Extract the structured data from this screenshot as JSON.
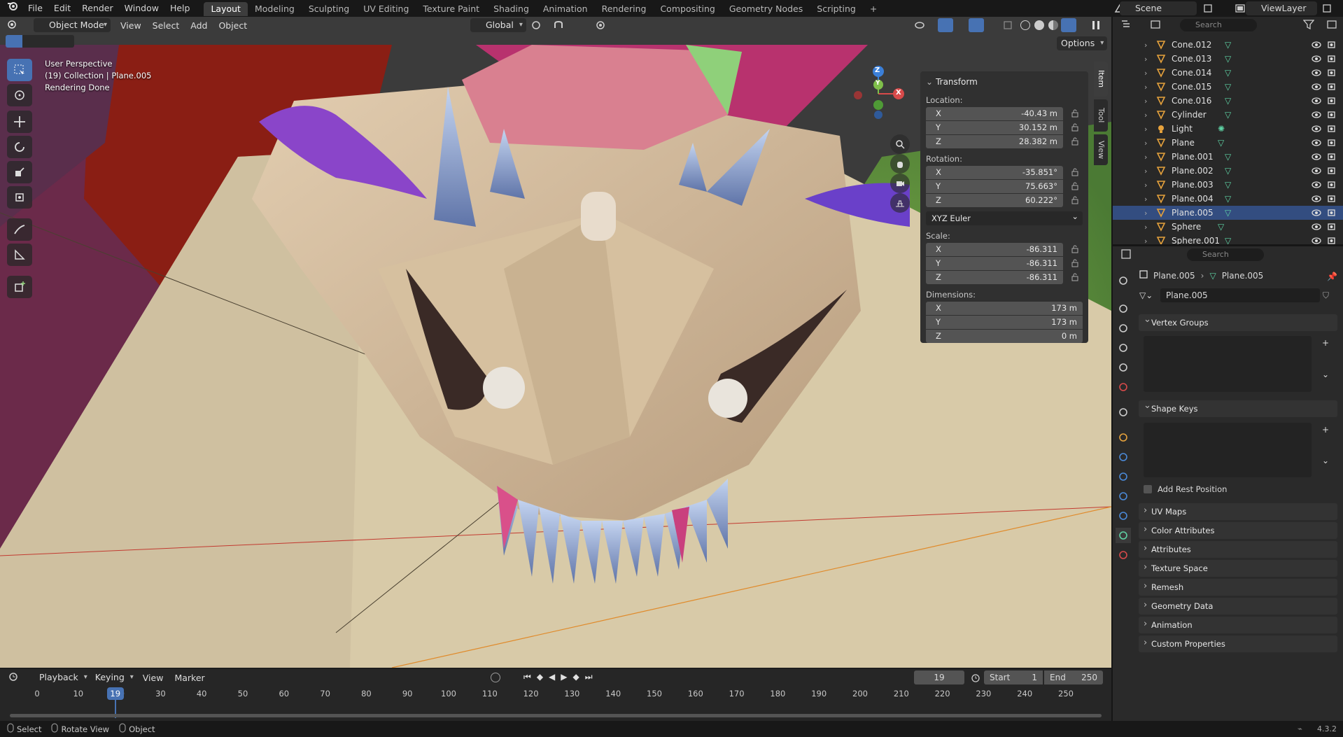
{
  "topbar": {
    "menus": [
      "File",
      "Edit",
      "Render",
      "Window",
      "Help"
    ],
    "workspaces": [
      "Layout",
      "Modeling",
      "Sculpting",
      "UV Editing",
      "Texture Paint",
      "Shading",
      "Animation",
      "Rendering",
      "Compositing",
      "Geometry Nodes",
      "Scripting"
    ],
    "add_workspace": "+",
    "scene": "Scene",
    "view_layer": "ViewLayer"
  },
  "viewport": {
    "mode": "Object Mode",
    "menus": [
      "View",
      "Select",
      "Add",
      "Object"
    ],
    "orientation": "Global",
    "options_label": "Options",
    "overlay_line1": "User Perspective",
    "overlay_line2": "(19) Collection | Plane.005",
    "overlay_line3": "Rendering Done",
    "gizmo_axes": [
      "Z",
      "Y",
      "X"
    ]
  },
  "npanel": {
    "title": "Transform",
    "location_label": "Location:",
    "location": [
      {
        "axis": "X",
        "value": "-40.43 m"
      },
      {
        "axis": "Y",
        "value": "30.152 m"
      },
      {
        "axis": "Z",
        "value": "28.382 m"
      }
    ],
    "rotation_label": "Rotation:",
    "rotation": [
      {
        "axis": "X",
        "value": "-35.851°"
      },
      {
        "axis": "Y",
        "value": "75.663°"
      },
      {
        "axis": "Z",
        "value": "60.222°"
      }
    ],
    "rotation_mode": "XYZ Euler",
    "scale_label": "Scale:",
    "scale": [
      {
        "axis": "X",
        "value": "-86.311"
      },
      {
        "axis": "Y",
        "value": "-86.311"
      },
      {
        "axis": "Z",
        "value": "-86.311"
      }
    ],
    "dimensions_label": "Dimensions:",
    "dimensions": [
      {
        "axis": "X",
        "value": "173 m"
      },
      {
        "axis": "Y",
        "value": "173 m"
      },
      {
        "axis": "Z",
        "value": "0 m"
      }
    ],
    "tabs": [
      "Item",
      "Tool",
      "View"
    ]
  },
  "outliner": {
    "search_placeholder": "Search",
    "items": [
      "Cone.012",
      "Cone.013",
      "Cone.014",
      "Cone.015",
      "Cone.016",
      "Cylinder",
      "Light",
      "Plane",
      "Plane.001",
      "Plane.002",
      "Plane.003",
      "Plane.004",
      "Plane.005",
      "Sphere",
      "Sphere.001"
    ],
    "selected": "Plane.005"
  },
  "properties": {
    "search_placeholder": "Search",
    "breadcrumb_object": "Plane.005",
    "breadcrumb_mesh": "Plane.005",
    "mesh_name": "Plane.005",
    "vertex_groups": "Vertex Groups",
    "shape_keys": "Shape Keys",
    "add_rest_position": "Add Rest Position",
    "collapsed_panels": [
      "UV Maps",
      "Color Attributes",
      "Attributes",
      "Texture Space",
      "Remesh",
      "Geometry Data",
      "Animation",
      "Custom Properties"
    ]
  },
  "timeline": {
    "menus": [
      "Playback",
      "Keying",
      "View",
      "Marker"
    ],
    "current_frame": "19",
    "start_label": "Start",
    "start": "1",
    "end_label": "End",
    "end": "250",
    "ticks": [
      "0",
      "10",
      "20",
      "30",
      "40",
      "50",
      "60",
      "70",
      "80",
      "90",
      "100",
      "110",
      "120",
      "130",
      "140",
      "150",
      "160",
      "170",
      "180",
      "190",
      "200",
      "210",
      "220",
      "230",
      "240",
      "250"
    ],
    "playhead_label": "19"
  },
  "statusbar": {
    "select": "Select",
    "rotate_view": "Rotate View",
    "object": "Object",
    "version": "4.3.2"
  },
  "colors": {
    "selection": "#4772b3",
    "outliner_selected": "#334d80",
    "mesh_icon": "#e6a23c",
    "data_icon": "#5fd3a5"
  }
}
